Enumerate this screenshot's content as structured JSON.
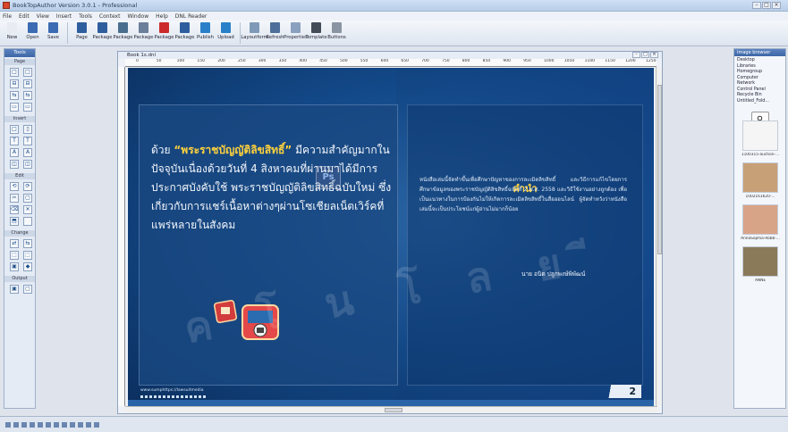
{
  "window": {
    "title": "BookTopAuthor Version 3.0.1 - Professional",
    "controls": [
      "–",
      "□",
      "×"
    ]
  },
  "menu": [
    "File",
    "Edit",
    "View",
    "Insert",
    "Tools",
    "Context",
    "Window",
    "Help",
    "DNL Reader"
  ],
  "toolbar": [
    {
      "label": "New",
      "color": "#e8ecf2"
    },
    {
      "label": "Open",
      "color": "#3b6bb2"
    },
    {
      "label": "Save",
      "color": "#3b6bb2"
    },
    {
      "label": "Page",
      "color": "#2f5e9e"
    },
    {
      "label": "Package",
      "color": "#2f5e9e"
    },
    {
      "label": "Package",
      "color": "#4a6e8e"
    },
    {
      "label": "Package",
      "color": "#6b7e9a"
    },
    {
      "label": "Package",
      "color": "#cc2a2a"
    },
    {
      "label": "Package",
      "color": "#2f5e9e"
    },
    {
      "label": "Publish",
      "color": "#2a80c8"
    },
    {
      "label": "Upload",
      "color": "#2a80c8"
    },
    {
      "label": "Layoutform",
      "color": "#7f9ab8"
    },
    {
      "label": "Refresh",
      "color": "#4d6f9a"
    },
    {
      "label": "Properties",
      "color": "#8aa0bf"
    },
    {
      "label": "Template",
      "color": "#444c58"
    },
    {
      "label": "Buttons",
      "color": "#8a94a2"
    }
  ],
  "left_panel": {
    "header": "Tools",
    "groups": [
      {
        "title": "Page",
        "tools": [
          "□",
          "□",
          "⊟",
          "⊟",
          "⇆",
          "⇆",
          "▭",
          "▭"
        ]
      },
      {
        "title": "Insert",
        "tools": [
          "□",
          "▯",
          "T",
          "T",
          "A",
          "A",
          "◫",
          "◫"
        ]
      },
      {
        "title": "Edit",
        "tools": [
          "⟲",
          "⟳",
          "✂",
          "▢",
          "⌫",
          "✕",
          "⬒",
          ""
        ]
      },
      {
        "title": "Change",
        "tools": [
          "⇄",
          "⇆",
          "⬚",
          "⬚",
          "▣",
          "◆"
        ]
      },
      {
        "title": "Output",
        "tools": [
          "▣",
          "▢"
        ]
      }
    ]
  },
  "document": {
    "tab_title": "Book 1s.dnl",
    "ruler_ticks": [
      "0",
      "50",
      "100",
      "150",
      "200",
      "250",
      "300",
      "350",
      "400",
      "450",
      "500",
      "550",
      "600",
      "650",
      "700",
      "750",
      "800",
      "850",
      "900",
      "950",
      "1000",
      "1050",
      "1100",
      "1150",
      "1200",
      "1250"
    ],
    "page": {
      "main_prefix": "ด้วย ",
      "main_highlight": "“พระราชบัญญัติลิขสิทธิ์”",
      "main_text": "มีความสำคัญมากในปัจจุบันเนื่องด้วยวันที่ 4 สิงหาคมที่ผ่านมาได้มีการประกาศบังคับใช้ พระราชบัญญัติลิขสิทธิ์ฉบับใหม่ ซึ่งเกี่ยวกับการแชร์เนื้อหาต่างๆผ่านโซเชียลเน็ตเวิร์คที่แพร่หลายในสังคม",
      "intro_title": "คำนำ",
      "intro_body": "หนังสือเล่มนี้จัดทำขึ้นเพื่อศึกษาปัญหาของการละเมิดลิขสิทธิ์ และวิธีการแก้ไขโดยการศึกษาข้อมูลของพระราชบัญญัติลิขสิทธิ์ฉบับที่ 2 พ.ศ. 2558 และวิธีใช้งานอย่างถูกต้อง เพื่อเป็นแนวทางในการป้องกันไม่ให้เกิดการละเมิดลิขสิทธิ์ในสื่อออนไลน์ ผู้จัดทำหวังว่าหนังสือเล่มนี้จะเป็นประโยชน์แก่ผู้อ่านไม่มากก็น้อย",
      "intro_author": "นาย อนิต ปลูกพงษ์พิพัฒน์",
      "ps_text": "Ps",
      "watermark": "ค โ น โ ล ย ี",
      "footer_url": "www.sumphttps://lawsuitmedia",
      "page_number": "2"
    }
  },
  "right_panel": {
    "header": "Image browser",
    "tree": [
      "Desktop",
      "Libraries",
      "Homegroup",
      "Computer",
      "Network",
      "Control Panel",
      "Recycle Bin",
      "Untitled_Fold..."
    ],
    "thumbs": [
      {
        "label": "1100315-auction-...",
        "color": "#f5f5f5"
      },
      {
        "label": "1002161620-...",
        "color": "#c8a078"
      },
      {
        "label": "AnnaSophia-Robb-...",
        "color": "#d8a488"
      },
      {
        "label": "ANNE",
        "color": "#8a7a5a"
      }
    ]
  },
  "statusbar": [
    "▣",
    "▣",
    "▣",
    "▣",
    "▣",
    "▣",
    "▣",
    "▣",
    "▣",
    "▣",
    "▣",
    "▣"
  ]
}
